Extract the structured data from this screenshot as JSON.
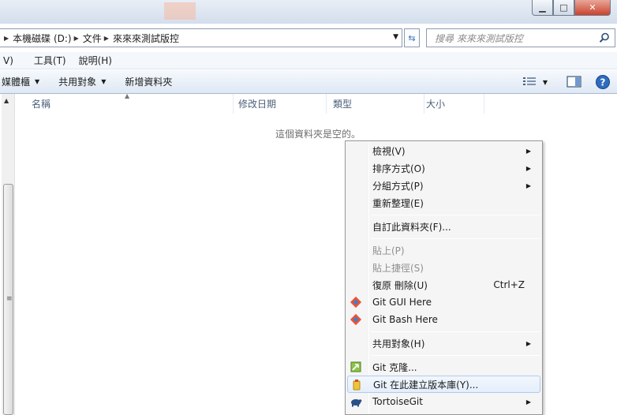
{
  "window": {
    "minimize_glyph": "▁",
    "maximize_glyph": "□",
    "close_glyph": "✕"
  },
  "address": {
    "crumbs": [
      "本機磁碟 (D:)",
      "文件",
      "來來來測試版控"
    ],
    "search_placeholder": "搜尋 來來來測試版控"
  },
  "menubar": {
    "items": [
      "V)",
      "工具(T)",
      "說明(H)"
    ]
  },
  "toolbar": {
    "media_library": "媒體櫃",
    "share_with": "共用對象",
    "new_folder": "新增資料夾"
  },
  "columns": {
    "name": "名稱",
    "date_modified": "修改日期",
    "type": "類型",
    "size": "大小"
  },
  "empty_message": "這個資料夾是空的。",
  "context_menu": {
    "view": "檢視(V)",
    "sort_by": "排序方式(O)",
    "group_by": "分組方式(P)",
    "refresh": "重新整理(E)",
    "customize": "自訂此資料夾(F)...",
    "paste": "貼上(P)",
    "paste_shortcut": "貼上捷徑(S)",
    "undo_delete": "復原 刪除(U)",
    "undo_shortcut": "Ctrl+Z",
    "git_gui": "Git GUI Here",
    "git_bash": "Git Bash Here",
    "share_with": "共用對象(H)",
    "git_clone": "Git 克隆...",
    "git_create_repo": "Git 在此建立版本庫(Y)...",
    "tortoisegit": "TortoiseGit"
  },
  "colors": {
    "highlight_border": "#aecbee",
    "toolbar_bg": "#dee8f4",
    "column_header_text": "#4c607a"
  }
}
